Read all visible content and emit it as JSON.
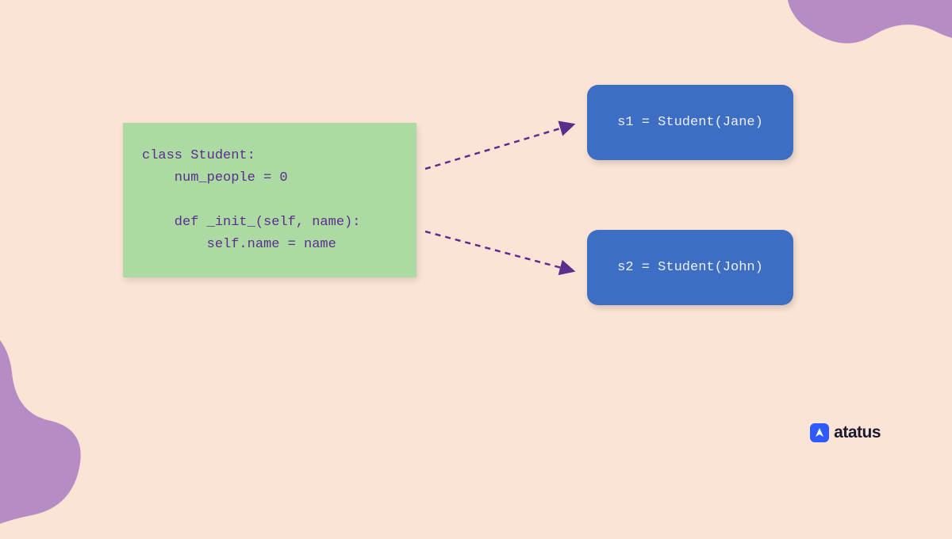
{
  "diagram": {
    "class_code": "class Student:\n    num_people = 0\n\n    def _init_(self, name):\n        self.name = name",
    "instances": [
      {
        "code": "s1 = Student(Jane)"
      },
      {
        "code": "s2 = Student(John)"
      }
    ]
  },
  "branding": {
    "name": "atatus"
  },
  "colors": {
    "background": "#FBE4D6",
    "code_box": "#ABDAA3",
    "instance_box": "#3E6DC4",
    "code_text": "#5B2E8C",
    "instance_text": "#EAF0FA",
    "blob": "#B58CC4",
    "arrow": "#5B2E8C",
    "logo_accent": "#2D5BFF"
  }
}
